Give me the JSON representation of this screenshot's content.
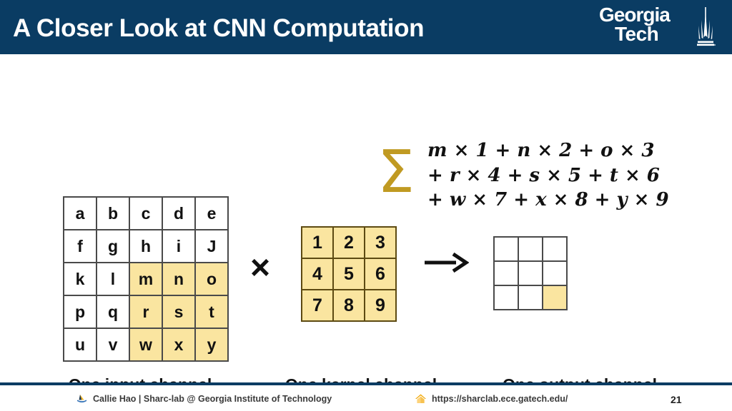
{
  "header": {
    "title": "A Closer Look at CNN Computation",
    "bar_color": "#0a3c63",
    "title_color": "#ffffff",
    "logo": {
      "line1": "Georgia",
      "line2": "Tech",
      "icon": "tech-tower-icon"
    }
  },
  "colors": {
    "navy": "#0a3c63",
    "highlight_yellow": "#fae5a0",
    "sigma_gold": "#c09a22",
    "grid_border": "#4a4a4a",
    "kernel_border": "#5d4a12"
  },
  "input_matrix": {
    "rows": 5,
    "cols": 5,
    "cells": [
      {
        "v": "a",
        "hl": false
      },
      {
        "v": "b",
        "hl": false
      },
      {
        "v": "c",
        "hl": false
      },
      {
        "v": "d",
        "hl": false
      },
      {
        "v": "e",
        "hl": false
      },
      {
        "v": "f",
        "hl": false
      },
      {
        "v": "g",
        "hl": false
      },
      {
        "v": "h",
        "hl": false
      },
      {
        "v": "i",
        "hl": false
      },
      {
        "v": "J",
        "hl": false
      },
      {
        "v": "k",
        "hl": false
      },
      {
        "v": "l",
        "hl": false
      },
      {
        "v": "m",
        "hl": true
      },
      {
        "v": "n",
        "hl": true
      },
      {
        "v": "o",
        "hl": true
      },
      {
        "v": "p",
        "hl": false
      },
      {
        "v": "q",
        "hl": false
      },
      {
        "v": "r",
        "hl": true
      },
      {
        "v": "s",
        "hl": true
      },
      {
        "v": "t",
        "hl": true
      },
      {
        "v": "u",
        "hl": false
      },
      {
        "v": "v",
        "hl": false
      },
      {
        "v": "w",
        "hl": true
      },
      {
        "v": "x",
        "hl": true
      },
      {
        "v": "y",
        "hl": true
      }
    ],
    "caption": "One input channel"
  },
  "kernel_matrix": {
    "rows": 3,
    "cols": 3,
    "cells": [
      {
        "v": "1",
        "hl": true
      },
      {
        "v": "2",
        "hl": true
      },
      {
        "v": "3",
        "hl": true
      },
      {
        "v": "4",
        "hl": true
      },
      {
        "v": "5",
        "hl": true
      },
      {
        "v": "6",
        "hl": true
      },
      {
        "v": "7",
        "hl": true
      },
      {
        "v": "8",
        "hl": true
      },
      {
        "v": "9",
        "hl": true
      }
    ],
    "caption": "One kernel channel"
  },
  "output_matrix": {
    "rows": 3,
    "cols": 3,
    "cells": [
      {
        "v": "",
        "hl": false
      },
      {
        "v": "",
        "hl": false
      },
      {
        "v": "",
        "hl": false
      },
      {
        "v": "",
        "hl": false
      },
      {
        "v": "",
        "hl": false
      },
      {
        "v": "",
        "hl": false
      },
      {
        "v": "",
        "hl": false
      },
      {
        "v": "",
        "hl": false
      },
      {
        "v": "",
        "hl": true
      }
    ],
    "caption": "One output channel"
  },
  "operators": {
    "multiply": "×",
    "arrow": "arrow-right-icon"
  },
  "formula": {
    "sigma": "Σ",
    "line1": "m × 1 + n × 2 + o × 3",
    "line2": "+ r × 4 + s × 5 + t × 6",
    "line3": "+ w × 7 + x × 8 + y × 9"
  },
  "footer": {
    "author": "Callie Hao | Sharc-lab @ Georgia Institute of Technology",
    "author_icon": "sharc-lab-logo-icon",
    "url": "https://sharclab.ece.gatech.edu/",
    "url_icon": "home-icon",
    "page_number": "21"
  }
}
